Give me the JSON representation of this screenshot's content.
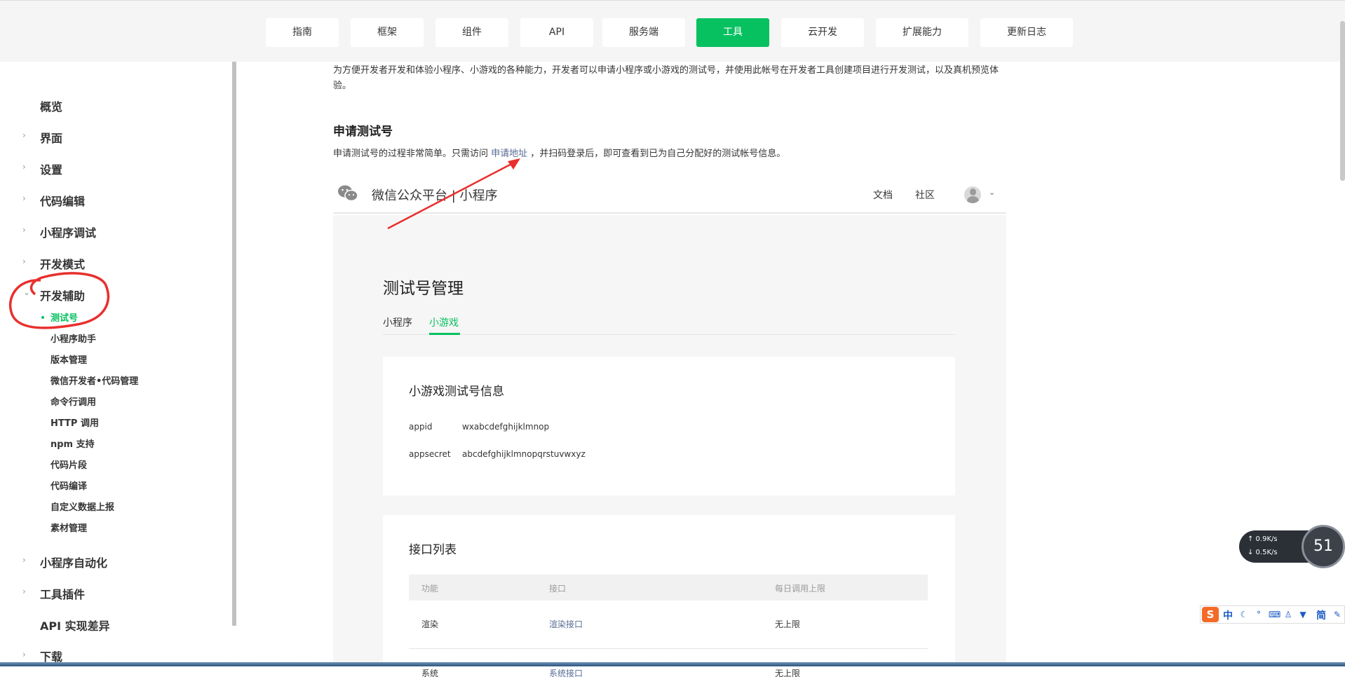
{
  "nav": {
    "tabs": [
      "指南",
      "框架",
      "组件",
      "API",
      "服务端",
      "工具",
      "云开发",
      "扩展能力",
      "更新日志"
    ],
    "active_tab": "工具"
  },
  "sidebar": {
    "items": {
      "overview": "概览",
      "interface": "界面",
      "settings": "设置",
      "code_edit": "代码编辑",
      "debug": "小程序调试",
      "dev_mode": "开发模式",
      "dev_assist": "开发辅助",
      "automation": "小程序自动化",
      "plugins": "工具插件",
      "api_diff": "API 实现差异",
      "download": "下载"
    },
    "sub_items": {
      "test_account": "测试号",
      "assistant": "小程序助手",
      "version_mgmt": "版本管理",
      "wx_dev_code": "微信开发者•代码管理",
      "cli": "命令行调用",
      "http": "HTTP 调用",
      "npm": "npm 支持",
      "snippet": "代码片段",
      "compile": "代码编译",
      "custom_report": "自定义数据上报",
      "assets": "素材管理"
    }
  },
  "content": {
    "intro": "为方便开发者开发和体验小程序、小游戏的各种能力，开发者可以申请小程序或小游戏的测试号，并使用此帐号在开发者工具创建项目进行开发测试，以及真机预览体验。",
    "heading": "申请测试号",
    "desc_before": "申请测试号的过程非常简单。只需访问 ",
    "desc_link": "申请地址",
    "desc_after": " ，并扫码登录后，即可查看到已为自己分配好的测试帐号信息。"
  },
  "screenshot": {
    "brand": "微信公众平台 | 小程序",
    "header_links": {
      "docs": "文档",
      "community": "社区"
    },
    "page_title": "测试号管理",
    "tabs": {
      "mini_program": "小程序",
      "mini_game": "小游戏"
    },
    "info_card": {
      "title": "小游戏测试号信息",
      "appid_label": "appid",
      "appid_value": "wxabcdefghijklmnop",
      "appsecret_label": "appsecret",
      "appsecret_value": "abcdefghijklmnopqrstuvwxyz"
    },
    "api_card": {
      "title": "接口列表",
      "columns": {
        "func": "功能",
        "api": "接口",
        "limit": "每日调用上限"
      },
      "rows": [
        {
          "func": "渲染",
          "api": "渲染接口",
          "limit": "无上限"
        },
        {
          "func": "系统",
          "api": "系统接口",
          "limit": "无上限"
        }
      ]
    }
  },
  "widgets": {
    "net_up": "↑ 0.9K/s",
    "net_down": "↓ 0.5K/s",
    "gauge": "51",
    "ime_lang": "中",
    "ime_mode": "简"
  },
  "colors": {
    "accent": "#07c160",
    "link": "#576b95",
    "annotation": "#e8302d"
  }
}
